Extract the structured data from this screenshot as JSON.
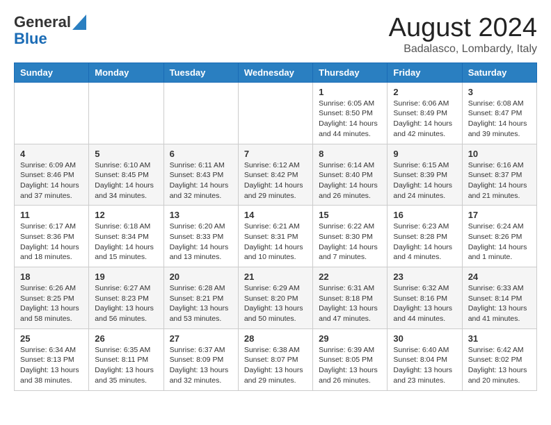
{
  "header": {
    "logo_line1": "General",
    "logo_line2": "Blue",
    "month_title": "August 2024",
    "location": "Badalasco, Lombardy, Italy"
  },
  "days_of_week": [
    "Sunday",
    "Monday",
    "Tuesday",
    "Wednesday",
    "Thursday",
    "Friday",
    "Saturday"
  ],
  "weeks": [
    [
      {
        "day": "",
        "info": ""
      },
      {
        "day": "",
        "info": ""
      },
      {
        "day": "",
        "info": ""
      },
      {
        "day": "",
        "info": ""
      },
      {
        "day": "1",
        "info": "Sunrise: 6:05 AM\nSunset: 8:50 PM\nDaylight: 14 hours and 44 minutes."
      },
      {
        "day": "2",
        "info": "Sunrise: 6:06 AM\nSunset: 8:49 PM\nDaylight: 14 hours and 42 minutes."
      },
      {
        "day": "3",
        "info": "Sunrise: 6:08 AM\nSunset: 8:47 PM\nDaylight: 14 hours and 39 minutes."
      }
    ],
    [
      {
        "day": "4",
        "info": "Sunrise: 6:09 AM\nSunset: 8:46 PM\nDaylight: 14 hours and 37 minutes."
      },
      {
        "day": "5",
        "info": "Sunrise: 6:10 AM\nSunset: 8:45 PM\nDaylight: 14 hours and 34 minutes."
      },
      {
        "day": "6",
        "info": "Sunrise: 6:11 AM\nSunset: 8:43 PM\nDaylight: 14 hours and 32 minutes."
      },
      {
        "day": "7",
        "info": "Sunrise: 6:12 AM\nSunset: 8:42 PM\nDaylight: 14 hours and 29 minutes."
      },
      {
        "day": "8",
        "info": "Sunrise: 6:14 AM\nSunset: 8:40 PM\nDaylight: 14 hours and 26 minutes."
      },
      {
        "day": "9",
        "info": "Sunrise: 6:15 AM\nSunset: 8:39 PM\nDaylight: 14 hours and 24 minutes."
      },
      {
        "day": "10",
        "info": "Sunrise: 6:16 AM\nSunset: 8:37 PM\nDaylight: 14 hours and 21 minutes."
      }
    ],
    [
      {
        "day": "11",
        "info": "Sunrise: 6:17 AM\nSunset: 8:36 PM\nDaylight: 14 hours and 18 minutes."
      },
      {
        "day": "12",
        "info": "Sunrise: 6:18 AM\nSunset: 8:34 PM\nDaylight: 14 hours and 15 minutes."
      },
      {
        "day": "13",
        "info": "Sunrise: 6:20 AM\nSunset: 8:33 PM\nDaylight: 14 hours and 13 minutes."
      },
      {
        "day": "14",
        "info": "Sunrise: 6:21 AM\nSunset: 8:31 PM\nDaylight: 14 hours and 10 minutes."
      },
      {
        "day": "15",
        "info": "Sunrise: 6:22 AM\nSunset: 8:30 PM\nDaylight: 14 hours and 7 minutes."
      },
      {
        "day": "16",
        "info": "Sunrise: 6:23 AM\nSunset: 8:28 PM\nDaylight: 14 hours and 4 minutes."
      },
      {
        "day": "17",
        "info": "Sunrise: 6:24 AM\nSunset: 8:26 PM\nDaylight: 14 hours and 1 minute."
      }
    ],
    [
      {
        "day": "18",
        "info": "Sunrise: 6:26 AM\nSunset: 8:25 PM\nDaylight: 13 hours and 58 minutes."
      },
      {
        "day": "19",
        "info": "Sunrise: 6:27 AM\nSunset: 8:23 PM\nDaylight: 13 hours and 56 minutes."
      },
      {
        "day": "20",
        "info": "Sunrise: 6:28 AM\nSunset: 8:21 PM\nDaylight: 13 hours and 53 minutes."
      },
      {
        "day": "21",
        "info": "Sunrise: 6:29 AM\nSunset: 8:20 PM\nDaylight: 13 hours and 50 minutes."
      },
      {
        "day": "22",
        "info": "Sunrise: 6:31 AM\nSunset: 8:18 PM\nDaylight: 13 hours and 47 minutes."
      },
      {
        "day": "23",
        "info": "Sunrise: 6:32 AM\nSunset: 8:16 PM\nDaylight: 13 hours and 44 minutes."
      },
      {
        "day": "24",
        "info": "Sunrise: 6:33 AM\nSunset: 8:14 PM\nDaylight: 13 hours and 41 minutes."
      }
    ],
    [
      {
        "day": "25",
        "info": "Sunrise: 6:34 AM\nSunset: 8:13 PM\nDaylight: 13 hours and 38 minutes."
      },
      {
        "day": "26",
        "info": "Sunrise: 6:35 AM\nSunset: 8:11 PM\nDaylight: 13 hours and 35 minutes."
      },
      {
        "day": "27",
        "info": "Sunrise: 6:37 AM\nSunset: 8:09 PM\nDaylight: 13 hours and 32 minutes."
      },
      {
        "day": "28",
        "info": "Sunrise: 6:38 AM\nSunset: 8:07 PM\nDaylight: 13 hours and 29 minutes."
      },
      {
        "day": "29",
        "info": "Sunrise: 6:39 AM\nSunset: 8:05 PM\nDaylight: 13 hours and 26 minutes."
      },
      {
        "day": "30",
        "info": "Sunrise: 6:40 AM\nSunset: 8:04 PM\nDaylight: 13 hours and 23 minutes."
      },
      {
        "day": "31",
        "info": "Sunrise: 6:42 AM\nSunset: 8:02 PM\nDaylight: 13 hours and 20 minutes."
      }
    ]
  ]
}
